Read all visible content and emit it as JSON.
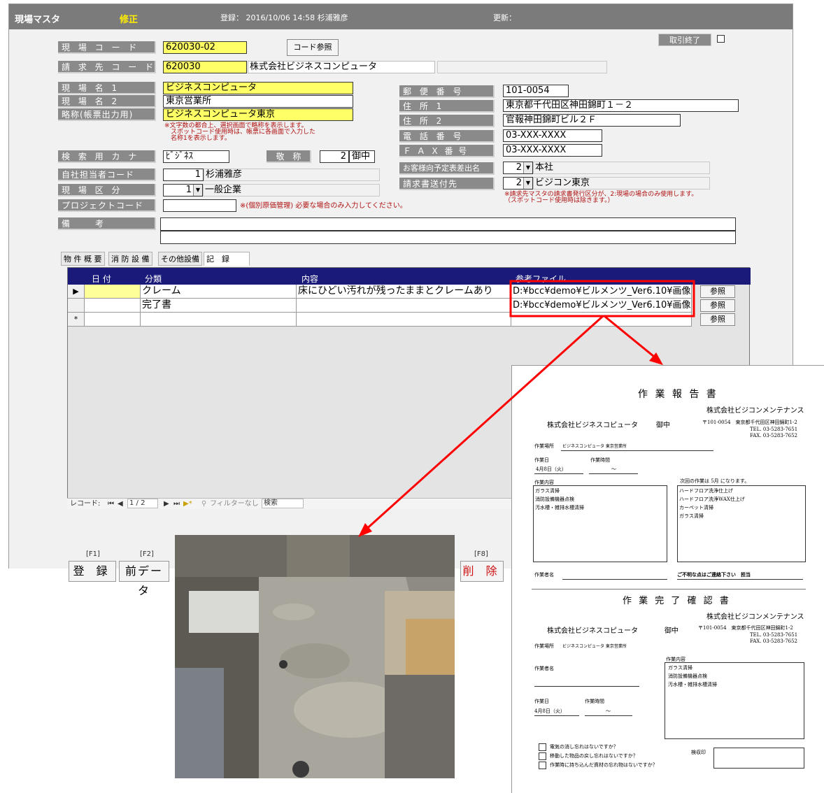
{
  "titlebar": {
    "title": "現場マスタ",
    "mode": "修正",
    "registered": "登録：  2016/10/06 14:58  杉浦雅彦",
    "updated": "更新："
  },
  "header_right": {
    "closed_label": "取引終了"
  },
  "fields": {
    "site_code": {
      "label": "現 場 コ ー ド",
      "value": "620030-02"
    },
    "code_ref_button": "コード参照",
    "billing_code": {
      "label": "請 求 先 コ ー ド",
      "value": "620030",
      "name": "株式会社ビジネスコンピュータ",
      "extra": ""
    },
    "site_name1": {
      "label": "現 場 名 1",
      "value": "ビジネスコンピュータ"
    },
    "site_name2": {
      "label": "現 場 名 2",
      "value": "東京営業所"
    },
    "short_name": {
      "label": "略称(帳票出力用)",
      "value": "ビジネスコンピュータ東京"
    },
    "short_name_note": "※文字数の都合上、選択画面で略称を表示します。\n　スポットコード使用時は、帳票に各画面で入力した\n　名称1を表示します。",
    "kana": {
      "label": "検 索 用 カ ナ",
      "value": "ﾋﾞｼﾞﾈｽ"
    },
    "honorific": {
      "label": "敬 称",
      "value": "2",
      "text": "御中"
    },
    "staff_code": {
      "label": "自社担当者コード",
      "value": "1",
      "name": "杉浦雅彦"
    },
    "site_type": {
      "label": "現 場 区 分",
      "value": "1",
      "text": "一般企業"
    },
    "project_code": {
      "label": "プロジェクトコード",
      "value": "",
      "note": "※(個別原価管理) 必要な場合のみ入力してください。"
    },
    "remarks": {
      "label": "備　　考",
      "value": ""
    },
    "postal": {
      "label": "郵 便 番 号",
      "value": "101-0054"
    },
    "address1": {
      "label": "住 所 1",
      "value": "東京都千代田区神田錦町１－２"
    },
    "address2": {
      "label": "住 所 2",
      "value": "官報神田錦町ビル２Ｆ"
    },
    "phone": {
      "label": "電 話 番 号",
      "value": "03-XXX-XXXX"
    },
    "fax": {
      "label": "Ｆ Ａ Ｘ 番 号",
      "value": "03-XXX-XXXX"
    },
    "schedule_addressee": {
      "label": "お客様向予定表差出名",
      "value": "2",
      "text": "本社"
    },
    "invoice_dest": {
      "label": "請求書送付先",
      "value": "2",
      "text": "ビジコン東京"
    },
    "invoice_note": "※請求先マスタの請求書発行区分が、2:現場の場合のみ使用します。\n（スポットコード使用時は除きます。）"
  },
  "tabs": [
    "物 件 概 要",
    "消 防 設 備",
    "その他設備",
    "記　録"
  ],
  "grid": {
    "columns": [
      "日 付",
      "分類",
      "内容",
      "参考ファイル"
    ],
    "rows": [
      {
        "selector": "▶",
        "date": "",
        "category": "クレーム",
        "content": "床にひどい汚れが残ったままとクレームあり",
        "file": "D:¥bcc¥demo¥ビルメンツ_Ver6.10¥画像",
        "button": "参照"
      },
      {
        "selector": "",
        "date": "",
        "category": "完了書",
        "content": "",
        "file": "D:¥bcc¥demo¥ビルメンツ_Ver6.10¥画像",
        "button": "参照"
      },
      {
        "selector": "*",
        "date": "",
        "category": "",
        "content": "",
        "file": "",
        "button": "参照"
      }
    ],
    "nav": {
      "prefix": "レコード: ",
      "position": "1 / 2",
      "filter": "フィルターなし",
      "search": "検索"
    }
  },
  "fkeys": [
    {
      "key": "[F1]",
      "label": "登 録"
    },
    {
      "key": "[F2]",
      "label": "前データ"
    },
    {
      "key": "[F8]",
      "label": "削 除"
    }
  ],
  "report": {
    "title1": "作 業 報 告 書",
    "vendor": "株式会社ビジコンメンテナンス",
    "client": "株式会社ビジネスコピュータ",
    "honorific": "御中",
    "vendor_addr": "〒101-0054　東京都千代田区神田錦町1-2",
    "tel": "TEL. 03-5283-7651",
    "fax": "FAX. 03-5283-7652",
    "site_label": "作業場所",
    "site_value": "ビジネスコンピュータ 東京営業所",
    "date_label": "作業日",
    "time_label": "作業時間",
    "date_value": "4月8日（火）",
    "time_value": "～",
    "content_label": "作業内容",
    "next_label": "次回の作業は 5月 になります。",
    "content_items": [
      "ガラス清掃",
      "消防設備機器点検",
      "汚水槽・雑排水槽清掃"
    ],
    "next_items": [
      "ハードフロア洗浄仕上げ",
      "ハードフロア洗浄WAX仕上げ",
      "カーペット清掃",
      "ガラス清掃"
    ],
    "worker_label": "作業者名",
    "contact": "ご不明な点はご連絡下さい　担当",
    "title2": "作 業 完 了 確 認 書",
    "client2": "株式会社ビジネスコピュータ",
    "worker_label2": "作業者名",
    "content_label2": "作業内容",
    "content_items2": [
      "ガラス清掃",
      "消防設備機器点検",
      "汚水槽・雑排水槽清掃"
    ],
    "checks": [
      "電気の消し忘れはないですか？",
      "移動した物品の戻し忘れはないですか？",
      "作業時に持ち込んだ資材の忘れ物はないですか？"
    ],
    "stamp_label": "検収印"
  },
  "colors": {
    "highlight": "#ff0000",
    "grid_header": "#1a1a7a",
    "required_field": "#ffff66"
  }
}
